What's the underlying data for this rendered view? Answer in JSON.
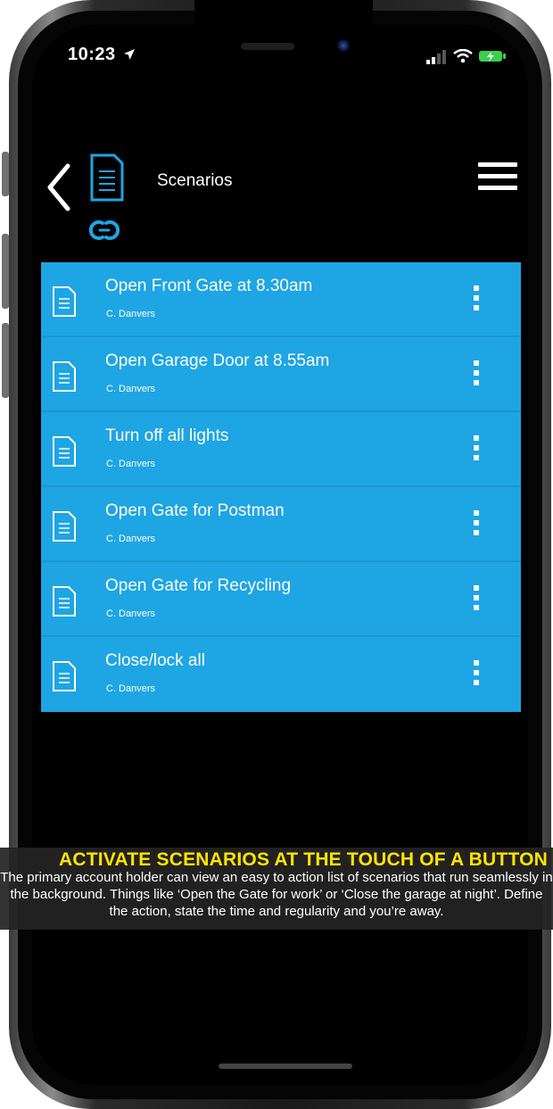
{
  "status_bar": {
    "time": "10:23"
  },
  "header": {
    "title": "Scenarios"
  },
  "scenarios": [
    {
      "title": "Open Front Gate at 8.30am",
      "owner": "C. Danvers"
    },
    {
      "title": "Open Garage Door at 8.55am",
      "owner": "C. Danvers"
    },
    {
      "title": "Turn off all lights",
      "owner": "C. Danvers"
    },
    {
      "title": "Open Gate for Postman",
      "owner": "C. Danvers"
    },
    {
      "title": "Open Gate for Recycling",
      "owner": "C. Danvers"
    },
    {
      "title": "Close/lock all",
      "owner": "C. Danvers"
    }
  ],
  "caption": {
    "headline": "ACTIVATE SCENARIOS AT THE TOUCH OF A BUTTON",
    "body": "The primary account holder can view an easy to action list of scenarios that run seamlessly in the background. Things like ‘Open the Gate for work’ or ‘Close the garage at night’. Define the action, state the time and regularity and you’re away."
  },
  "colors": {
    "list_bg": "#1ea5e3",
    "headline": "#ffe400",
    "link_icon": "#1ea5e3",
    "screen_bg": "#000000"
  },
  "icons": {
    "back": "chevron-left-icon",
    "document": "document-icon",
    "link": "link-icon",
    "menu": "hamburger-menu-icon",
    "item_file": "file-icon",
    "more": "more-vertical-icon",
    "signal": "signal-icon",
    "wifi": "wifi-icon",
    "battery": "battery-icon",
    "location": "location-arrow-icon"
  }
}
